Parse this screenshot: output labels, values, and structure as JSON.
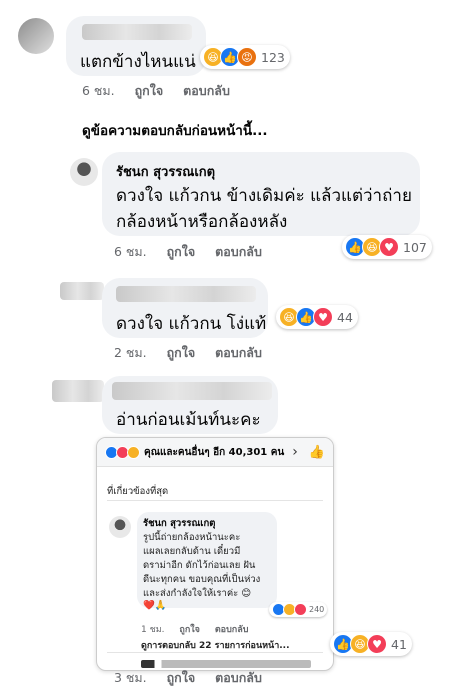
{
  "comments": [
    {
      "text": "แตกข้างไหนแน่",
      "time": "6 ชม.",
      "like": "ถูกใจ",
      "reply": "ตอบกลับ",
      "reaction_count": "123",
      "reactions": [
        "haha-icon",
        "like-icon",
        "angry-icon"
      ]
    }
  ],
  "view_prev": "ดูข้อความตอบกลับก่อนหน้านี้...",
  "replies": [
    {
      "name": "รัชนก สุวรรณเกตุ",
      "line1": "ดวงใจ แก้วกน ข้างเดิมค่ะ แล้วแต่ว่าถ่าย",
      "line2": "กล้องหน้าหรือกล้องหลัง",
      "time": "6 ชม.",
      "like": "ถูกใจ",
      "reply": "ตอบกลับ",
      "reaction_count": "107"
    },
    {
      "text": "ดวงใจ แก้วกน โง่แท้",
      "time": "2 ชม.",
      "like": "ถูกใจ",
      "reply": "ตอบกลับ",
      "reaction_count": "44"
    },
    {
      "text": "อ่านก่อนเม้นท์นะคะ",
      "time": "3 ชม.",
      "like": "ถูกใจ",
      "reply": "ตอบกลับ",
      "reaction_count": "41"
    }
  ],
  "screenshot": {
    "header": "คุณและคนอื่นๆ อีก 40,301 คน",
    "sort": "ที่เกี่ยวข้องที่สุด",
    "name": "รัชนก สุวรรณเกตุ",
    "lines": [
      "รูปนี้ถ่ายกล้องหน้านะคะ",
      "แผลเลยกลับด้าน เดี๋ยวมี",
      "ดราม่าอีก ดักไว้ก่อนเลย ฝัน",
      "ดีนะทุกคน ขอบคุณที่เป็นห่วง",
      "และส่งกำลังใจให้เราค่ะ 😊"
    ],
    "emoji_line": "❤️🙏",
    "reaction_count": "240",
    "time": "1 ชม.",
    "like": "ถูกใจ",
    "reply": "ตอบกลับ",
    "more_replies": "ดูการตอบกลับ 22 รายการก่อนหน้า..."
  },
  "colors": {
    "like": "#1877f2",
    "love": "#f33e58",
    "haha": "#f7b125",
    "angry": "#e9710f"
  }
}
